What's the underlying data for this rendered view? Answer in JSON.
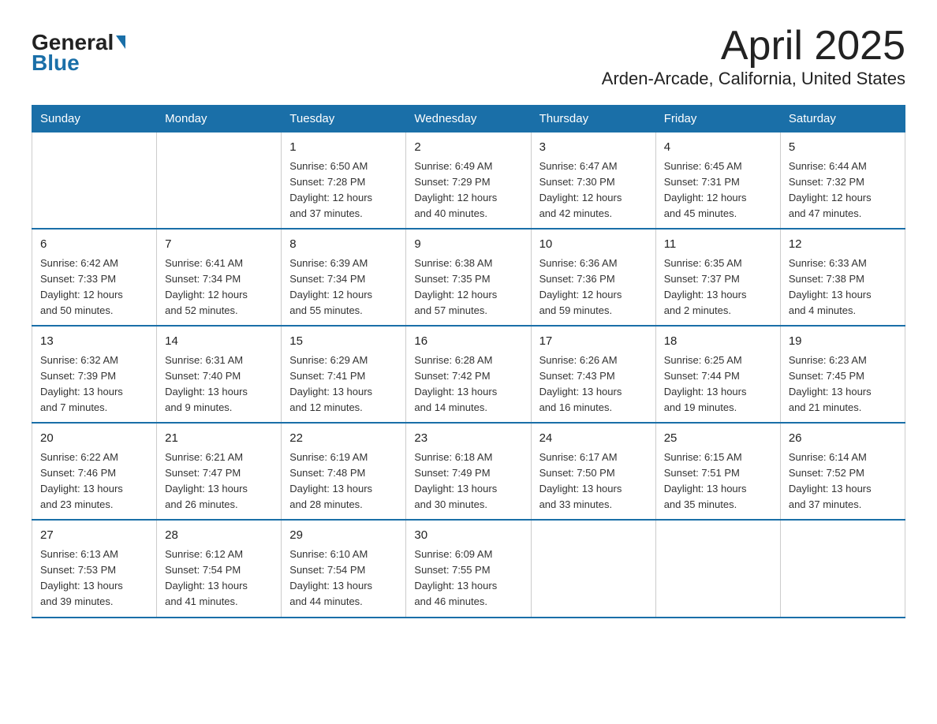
{
  "header": {
    "logo_general": "General",
    "logo_blue": "Blue",
    "title": "April 2025",
    "subtitle": "Arden-Arcade, California, United States"
  },
  "weekdays": [
    "Sunday",
    "Monday",
    "Tuesday",
    "Wednesday",
    "Thursday",
    "Friday",
    "Saturday"
  ],
  "weeks": [
    [
      {
        "day": "",
        "info": ""
      },
      {
        "day": "",
        "info": ""
      },
      {
        "day": "1",
        "info": "Sunrise: 6:50 AM\nSunset: 7:28 PM\nDaylight: 12 hours\nand 37 minutes."
      },
      {
        "day": "2",
        "info": "Sunrise: 6:49 AM\nSunset: 7:29 PM\nDaylight: 12 hours\nand 40 minutes."
      },
      {
        "day": "3",
        "info": "Sunrise: 6:47 AM\nSunset: 7:30 PM\nDaylight: 12 hours\nand 42 minutes."
      },
      {
        "day": "4",
        "info": "Sunrise: 6:45 AM\nSunset: 7:31 PM\nDaylight: 12 hours\nand 45 minutes."
      },
      {
        "day": "5",
        "info": "Sunrise: 6:44 AM\nSunset: 7:32 PM\nDaylight: 12 hours\nand 47 minutes."
      }
    ],
    [
      {
        "day": "6",
        "info": "Sunrise: 6:42 AM\nSunset: 7:33 PM\nDaylight: 12 hours\nand 50 minutes."
      },
      {
        "day": "7",
        "info": "Sunrise: 6:41 AM\nSunset: 7:34 PM\nDaylight: 12 hours\nand 52 minutes."
      },
      {
        "day": "8",
        "info": "Sunrise: 6:39 AM\nSunset: 7:34 PM\nDaylight: 12 hours\nand 55 minutes."
      },
      {
        "day": "9",
        "info": "Sunrise: 6:38 AM\nSunset: 7:35 PM\nDaylight: 12 hours\nand 57 minutes."
      },
      {
        "day": "10",
        "info": "Sunrise: 6:36 AM\nSunset: 7:36 PM\nDaylight: 12 hours\nand 59 minutes."
      },
      {
        "day": "11",
        "info": "Sunrise: 6:35 AM\nSunset: 7:37 PM\nDaylight: 13 hours\nand 2 minutes."
      },
      {
        "day": "12",
        "info": "Sunrise: 6:33 AM\nSunset: 7:38 PM\nDaylight: 13 hours\nand 4 minutes."
      }
    ],
    [
      {
        "day": "13",
        "info": "Sunrise: 6:32 AM\nSunset: 7:39 PM\nDaylight: 13 hours\nand 7 minutes."
      },
      {
        "day": "14",
        "info": "Sunrise: 6:31 AM\nSunset: 7:40 PM\nDaylight: 13 hours\nand 9 minutes."
      },
      {
        "day": "15",
        "info": "Sunrise: 6:29 AM\nSunset: 7:41 PM\nDaylight: 13 hours\nand 12 minutes."
      },
      {
        "day": "16",
        "info": "Sunrise: 6:28 AM\nSunset: 7:42 PM\nDaylight: 13 hours\nand 14 minutes."
      },
      {
        "day": "17",
        "info": "Sunrise: 6:26 AM\nSunset: 7:43 PM\nDaylight: 13 hours\nand 16 minutes."
      },
      {
        "day": "18",
        "info": "Sunrise: 6:25 AM\nSunset: 7:44 PM\nDaylight: 13 hours\nand 19 minutes."
      },
      {
        "day": "19",
        "info": "Sunrise: 6:23 AM\nSunset: 7:45 PM\nDaylight: 13 hours\nand 21 minutes."
      }
    ],
    [
      {
        "day": "20",
        "info": "Sunrise: 6:22 AM\nSunset: 7:46 PM\nDaylight: 13 hours\nand 23 minutes."
      },
      {
        "day": "21",
        "info": "Sunrise: 6:21 AM\nSunset: 7:47 PM\nDaylight: 13 hours\nand 26 minutes."
      },
      {
        "day": "22",
        "info": "Sunrise: 6:19 AM\nSunset: 7:48 PM\nDaylight: 13 hours\nand 28 minutes."
      },
      {
        "day": "23",
        "info": "Sunrise: 6:18 AM\nSunset: 7:49 PM\nDaylight: 13 hours\nand 30 minutes."
      },
      {
        "day": "24",
        "info": "Sunrise: 6:17 AM\nSunset: 7:50 PM\nDaylight: 13 hours\nand 33 minutes."
      },
      {
        "day": "25",
        "info": "Sunrise: 6:15 AM\nSunset: 7:51 PM\nDaylight: 13 hours\nand 35 minutes."
      },
      {
        "day": "26",
        "info": "Sunrise: 6:14 AM\nSunset: 7:52 PM\nDaylight: 13 hours\nand 37 minutes."
      }
    ],
    [
      {
        "day": "27",
        "info": "Sunrise: 6:13 AM\nSunset: 7:53 PM\nDaylight: 13 hours\nand 39 minutes."
      },
      {
        "day": "28",
        "info": "Sunrise: 6:12 AM\nSunset: 7:54 PM\nDaylight: 13 hours\nand 41 minutes."
      },
      {
        "day": "29",
        "info": "Sunrise: 6:10 AM\nSunset: 7:54 PM\nDaylight: 13 hours\nand 44 minutes."
      },
      {
        "day": "30",
        "info": "Sunrise: 6:09 AM\nSunset: 7:55 PM\nDaylight: 13 hours\nand 46 minutes."
      },
      {
        "day": "",
        "info": ""
      },
      {
        "day": "",
        "info": ""
      },
      {
        "day": "",
        "info": ""
      }
    ]
  ]
}
